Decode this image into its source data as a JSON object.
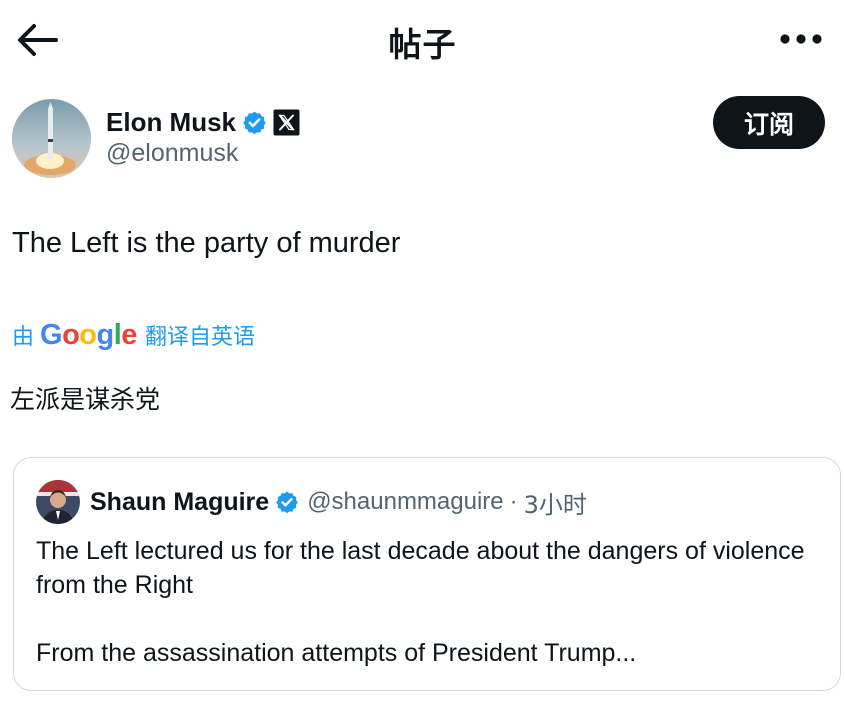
{
  "header": {
    "title": "帖子",
    "back_icon": "arrow-left-icon",
    "more_icon": "more-horizontal-icon"
  },
  "author": {
    "name": "Elon Musk",
    "handle": "@elonmusk",
    "verified_icon": "verified-badge-icon",
    "affiliation_icon": "x-logo-icon",
    "avatar": "rocket-launch-avatar"
  },
  "subscribe_label": "订阅",
  "tweet": {
    "text": "The Left is the party of murder",
    "translate_prefix": "由",
    "translate_provider": "Google",
    "translate_suffix": "翻译自英语",
    "translated_text": "左派是谋杀党"
  },
  "quoted": {
    "name": "Shaun Maguire",
    "handle": "@shaunmmaguire",
    "separator": "·",
    "time": "3小时",
    "text": "The Left lectured us for the last decade about the dangers of violence from the Right",
    "text_continued": "From the assassination attempts of President Trump..."
  },
  "colors": {
    "accent": "#1d9bf0",
    "text": "#0f1419",
    "muted": "#536471",
    "border": "#cfd9de",
    "button_bg": "#0f1419"
  }
}
